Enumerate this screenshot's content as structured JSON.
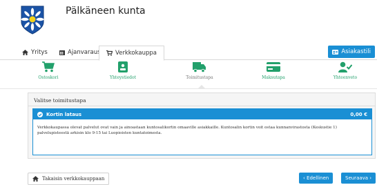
{
  "header": {
    "org_name": "Pälkäneen kunta"
  },
  "topnav": {
    "tabs": [
      {
        "label": "Yritys",
        "icon": "home-icon"
      },
      {
        "label": "Ajanvaraus",
        "icon": "calendar-icon"
      },
      {
        "label": "Verkkokauppa",
        "icon": "cart-icon"
      }
    ],
    "account_button": "Asiakastili"
  },
  "steps": [
    {
      "label": "Ostoskori",
      "icon": "cart-icon"
    },
    {
      "label": "Yhteystiedot",
      "icon": "contact-card-icon"
    },
    {
      "label": "Toimitustapa",
      "icon": "truck-icon"
    },
    {
      "label": "Maksutapa",
      "icon": "credit-card-icon"
    },
    {
      "label": "Yhteenveto",
      "icon": "user-check-icon"
    }
  ],
  "delivery": {
    "title": "Valitse toimitustapa",
    "option": {
      "name": "Kortin lataus",
      "price": "0,00 €",
      "description": "Verkkokaupassa olevat palvelut ovat vain ja ainoastaan kuntosalikortin omaaville asiakkaille. Kuntosalin kortin voit ostaa kunnanvirastosta (Keskustie 1) palvelupisteestä arkisin klo 9-15 tai Luopioisten kuntatoimesta."
    }
  },
  "footer": {
    "back": "Takaisin verkkokauppaan",
    "prev": "‹ Edellinen",
    "next": "Seuraava ›"
  },
  "colors": {
    "accent": "#1a8fd4",
    "step_green": "#22a06b"
  }
}
